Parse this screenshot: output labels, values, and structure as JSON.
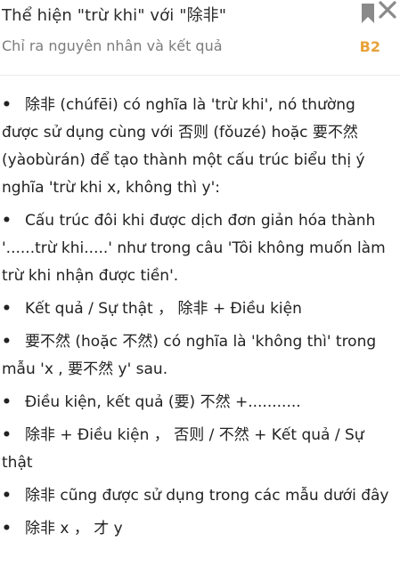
{
  "header": {
    "title": "Thể hiện \"trừ khi\" với \"除非\"",
    "subtitle": "Chỉ ra nguyên nhân và kết quả",
    "level": "B2",
    "bookmark_icon": "bookmark-icon",
    "close_icon": "close-icon"
  },
  "bullet_symbol": "•",
  "paragraphs": [
    {
      "text": "除非 (chúfēi) có nghĩa là 'trừ khi', nó thường được sử dụng cùng với 否则 (fǒuzé) hoặc 要不然 (yàobùrán) để tạo thành một cấu trúc biểu thị ý nghĩa 'trừ khi x, không thì y':"
    },
    {
      "text": "Cấu trúc đôi khi được dịch đơn giản hóa thành '......trừ khi.....' như trong câu 'Tôi không muốn làm trừ khi nhận được tiền'."
    },
    {
      "text": "Kết quả / Sự thật ，  除非 + Điều kiện"
    },
    {
      "text": "要不然 (hoặc 不然) có nghĩa là 'không thì' trong mẫu 'x , 要不然 y' sau."
    },
    {
      "text": "Điều kiện, kết quả (要) 不然 +..........."
    },
    {
      "text": "除非 + Điều kiện ，  否则 / 不然 + Kết quả / Sự thật"
    },
    {
      "text": "除非 cũng được sử dụng trong các mẫu dưới đây"
    },
    {
      "text": "除非 x ，  才 y"
    }
  ]
}
